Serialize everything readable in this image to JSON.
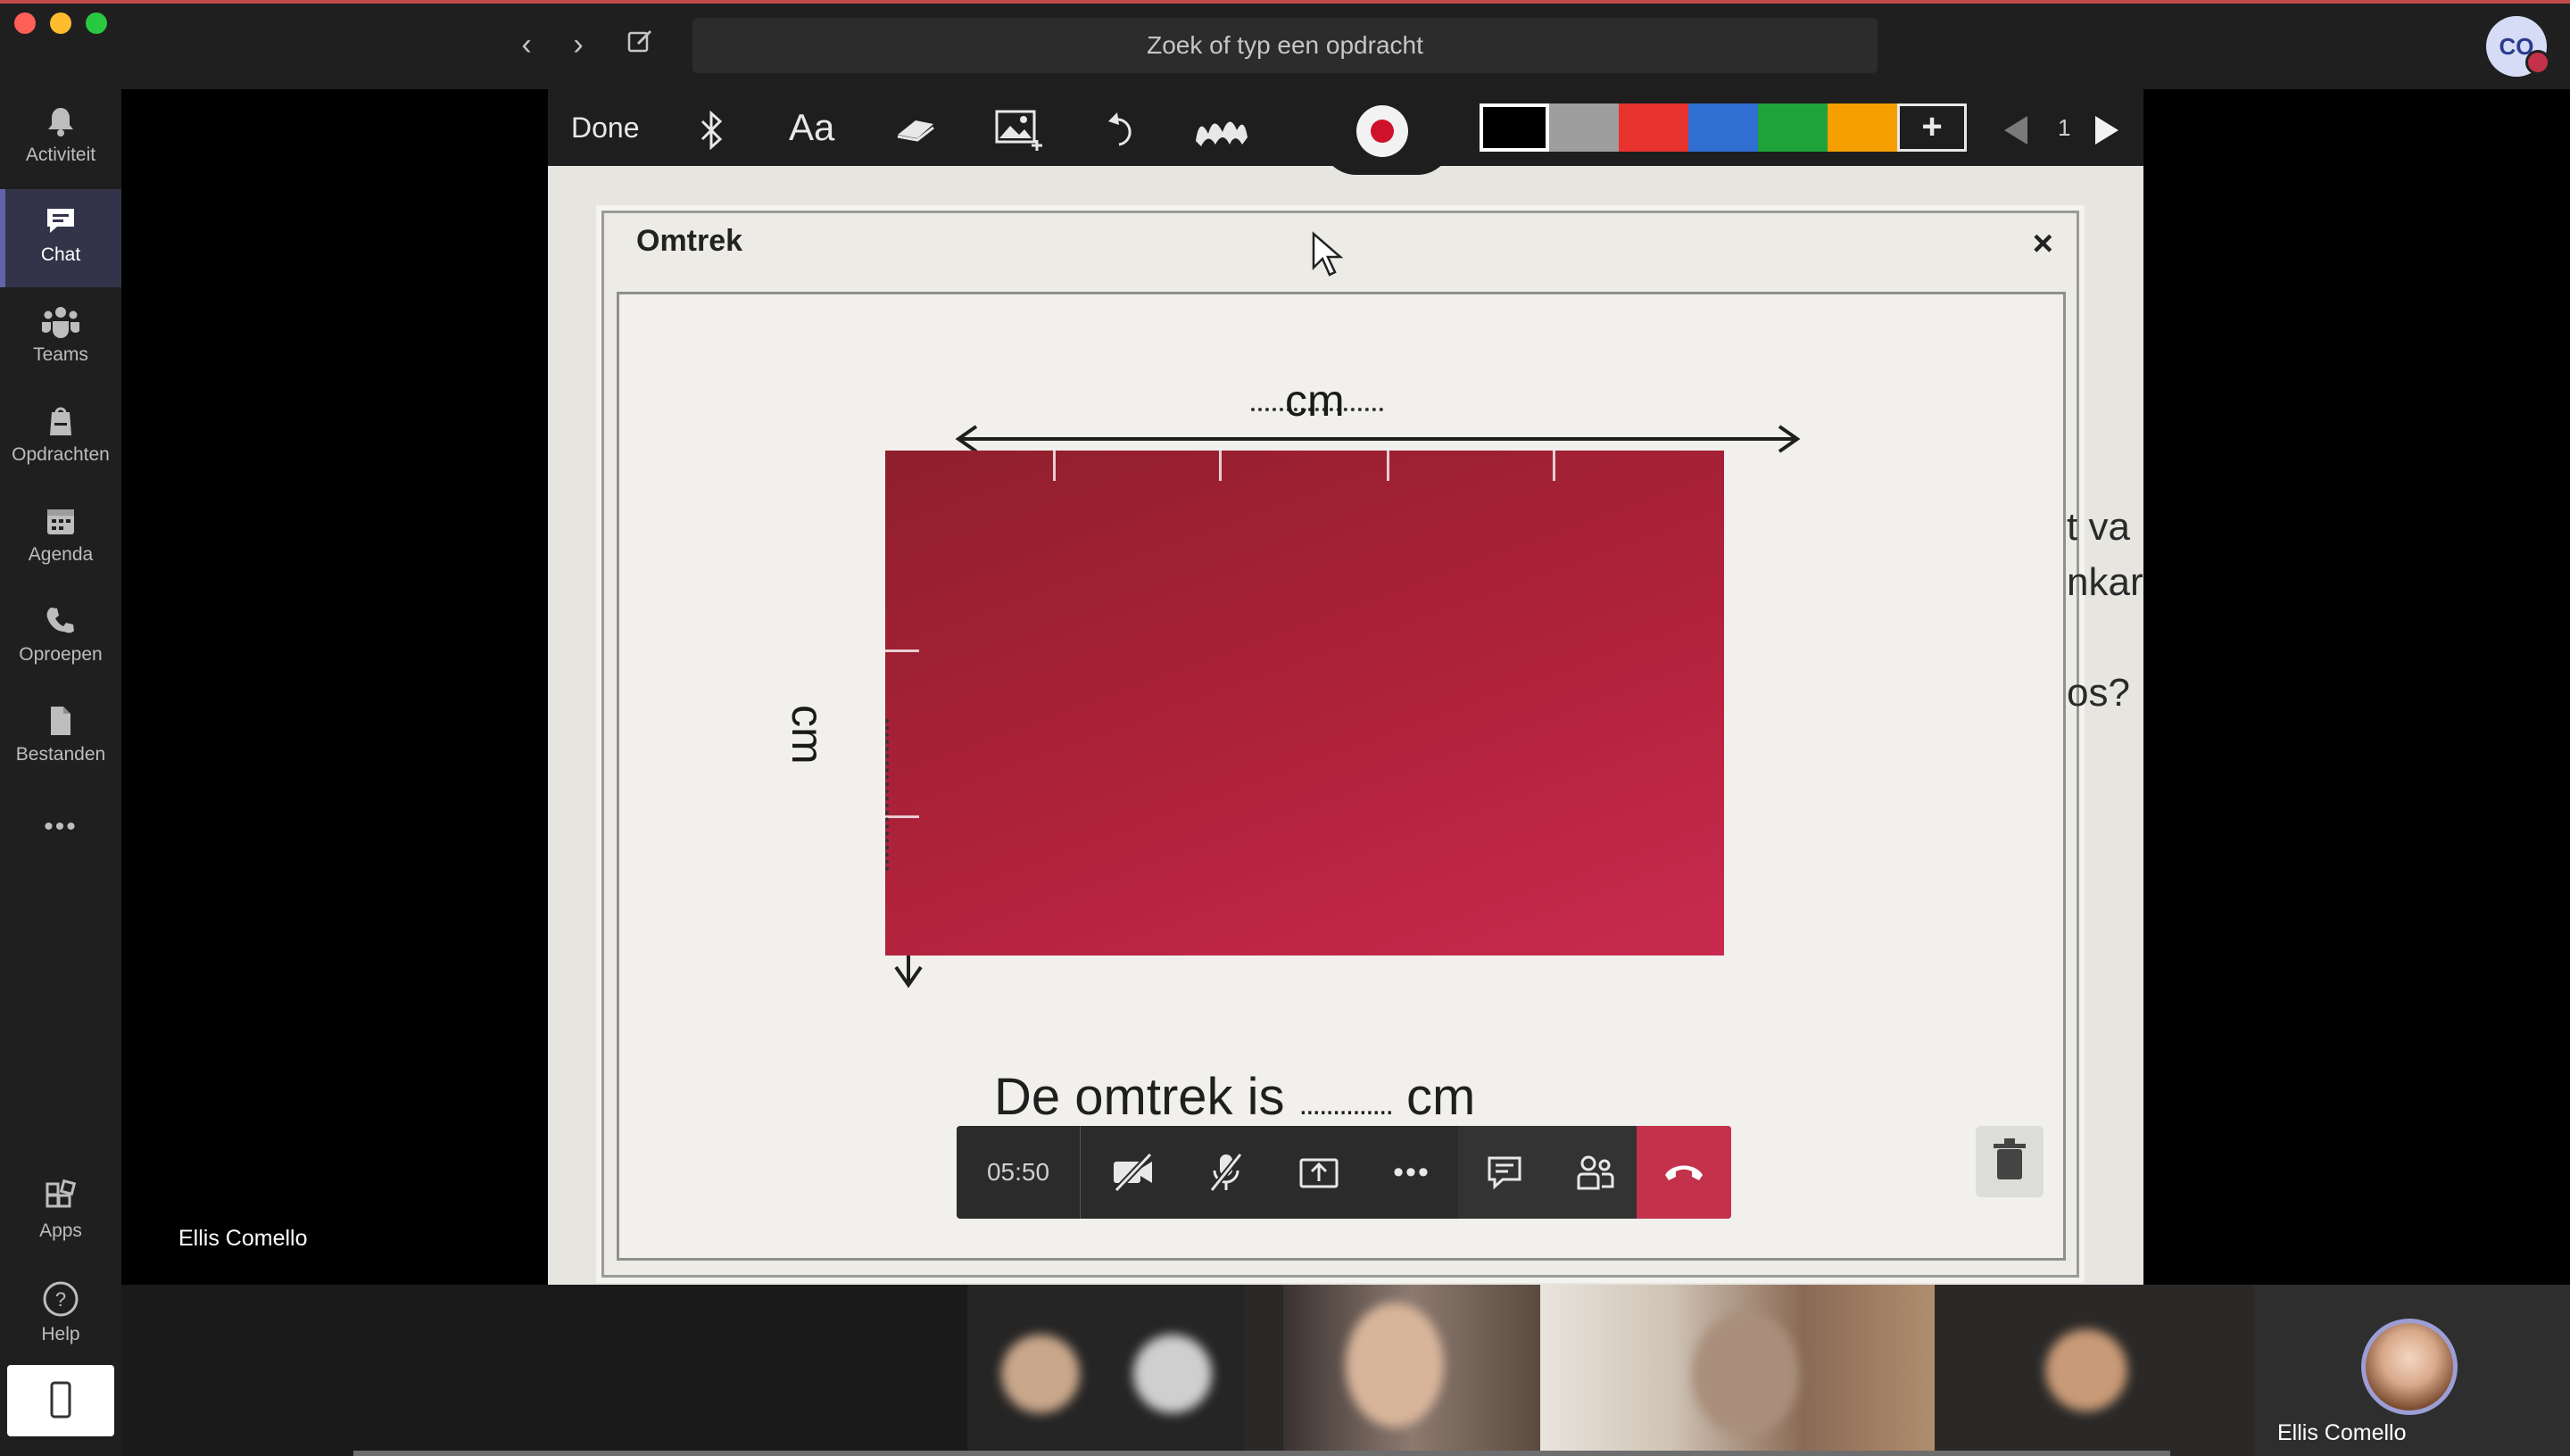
{
  "titlebar": {
    "search_placeholder": "Zoek of typ een opdracht",
    "avatar_initials": "CO"
  },
  "rail": {
    "items": [
      {
        "label": "Activiteit",
        "icon": "bell-icon"
      },
      {
        "label": "Chat",
        "icon": "chat-icon",
        "active": true
      },
      {
        "label": "Teams",
        "icon": "teams-icon"
      },
      {
        "label": "Opdrachten",
        "icon": "assignments-icon"
      },
      {
        "label": "Agenda",
        "icon": "calendar-icon"
      },
      {
        "label": "Oproepen",
        "icon": "phone-icon"
      },
      {
        "label": "Bestanden",
        "icon": "file-icon"
      }
    ],
    "more_label": "•••",
    "apps_label": "Apps",
    "help_label": "Help"
  },
  "meeting": {
    "presenter_name": "Ellis Comello",
    "self_name": "Ellis Comello",
    "timer": "05:50"
  },
  "whiteboard": {
    "done_label": "Done",
    "font_label": "Aa",
    "page_number": "1",
    "colors": [
      "#000000",
      "#9e9e9e",
      "#e8332e",
      "#2f6fd1",
      "#1fa23a",
      "#f5a000"
    ],
    "selected_color": "#000000",
    "add_label": "+"
  },
  "worksheet": {
    "title": "Omtrek",
    "close": "×",
    "top_unit": "cm",
    "left_unit": "cm",
    "answer_prefix": "De omtrek is",
    "answer_dots": "..............",
    "answer_unit": "cm",
    "side_text": [
      "t va",
      "nkar",
      "",
      "os?"
    ]
  },
  "colors": {
    "accent": "#6264a7",
    "hangup": "#c4314b",
    "rect": "#b0223a"
  }
}
